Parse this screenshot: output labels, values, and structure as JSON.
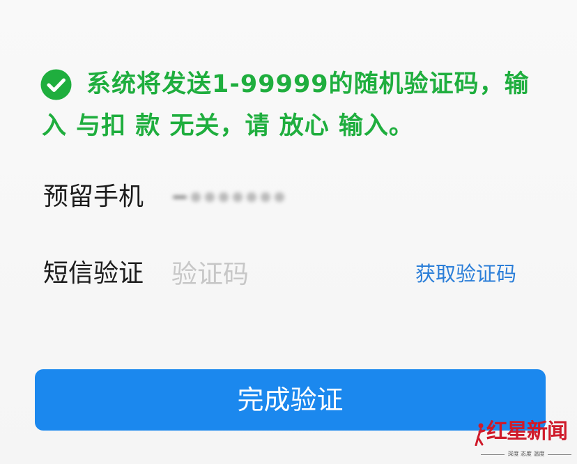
{
  "notice": {
    "icon": "check-circle-icon",
    "line1": "系统将发送1-99999的随机验证码，输",
    "line2": "入 与扣 款 无关，请 放心 输入。"
  },
  "form": {
    "phone_row": {
      "label": "预留手机"
    },
    "sms_row": {
      "label": "短信验证",
      "placeholder": "验证码",
      "get_code_label": "获取验证码"
    }
  },
  "submit_label": "完成验证",
  "watermark": {
    "logo_text": "红星新闻",
    "tagline": "深度 态度 温度"
  },
  "colors": {
    "notice_green": "#1fae3e",
    "link_blue": "#2b7ed8",
    "button_blue": "#1b88ee",
    "placeholder_gray": "#c7c7c7",
    "watermark_red": "#cf1a2a"
  }
}
